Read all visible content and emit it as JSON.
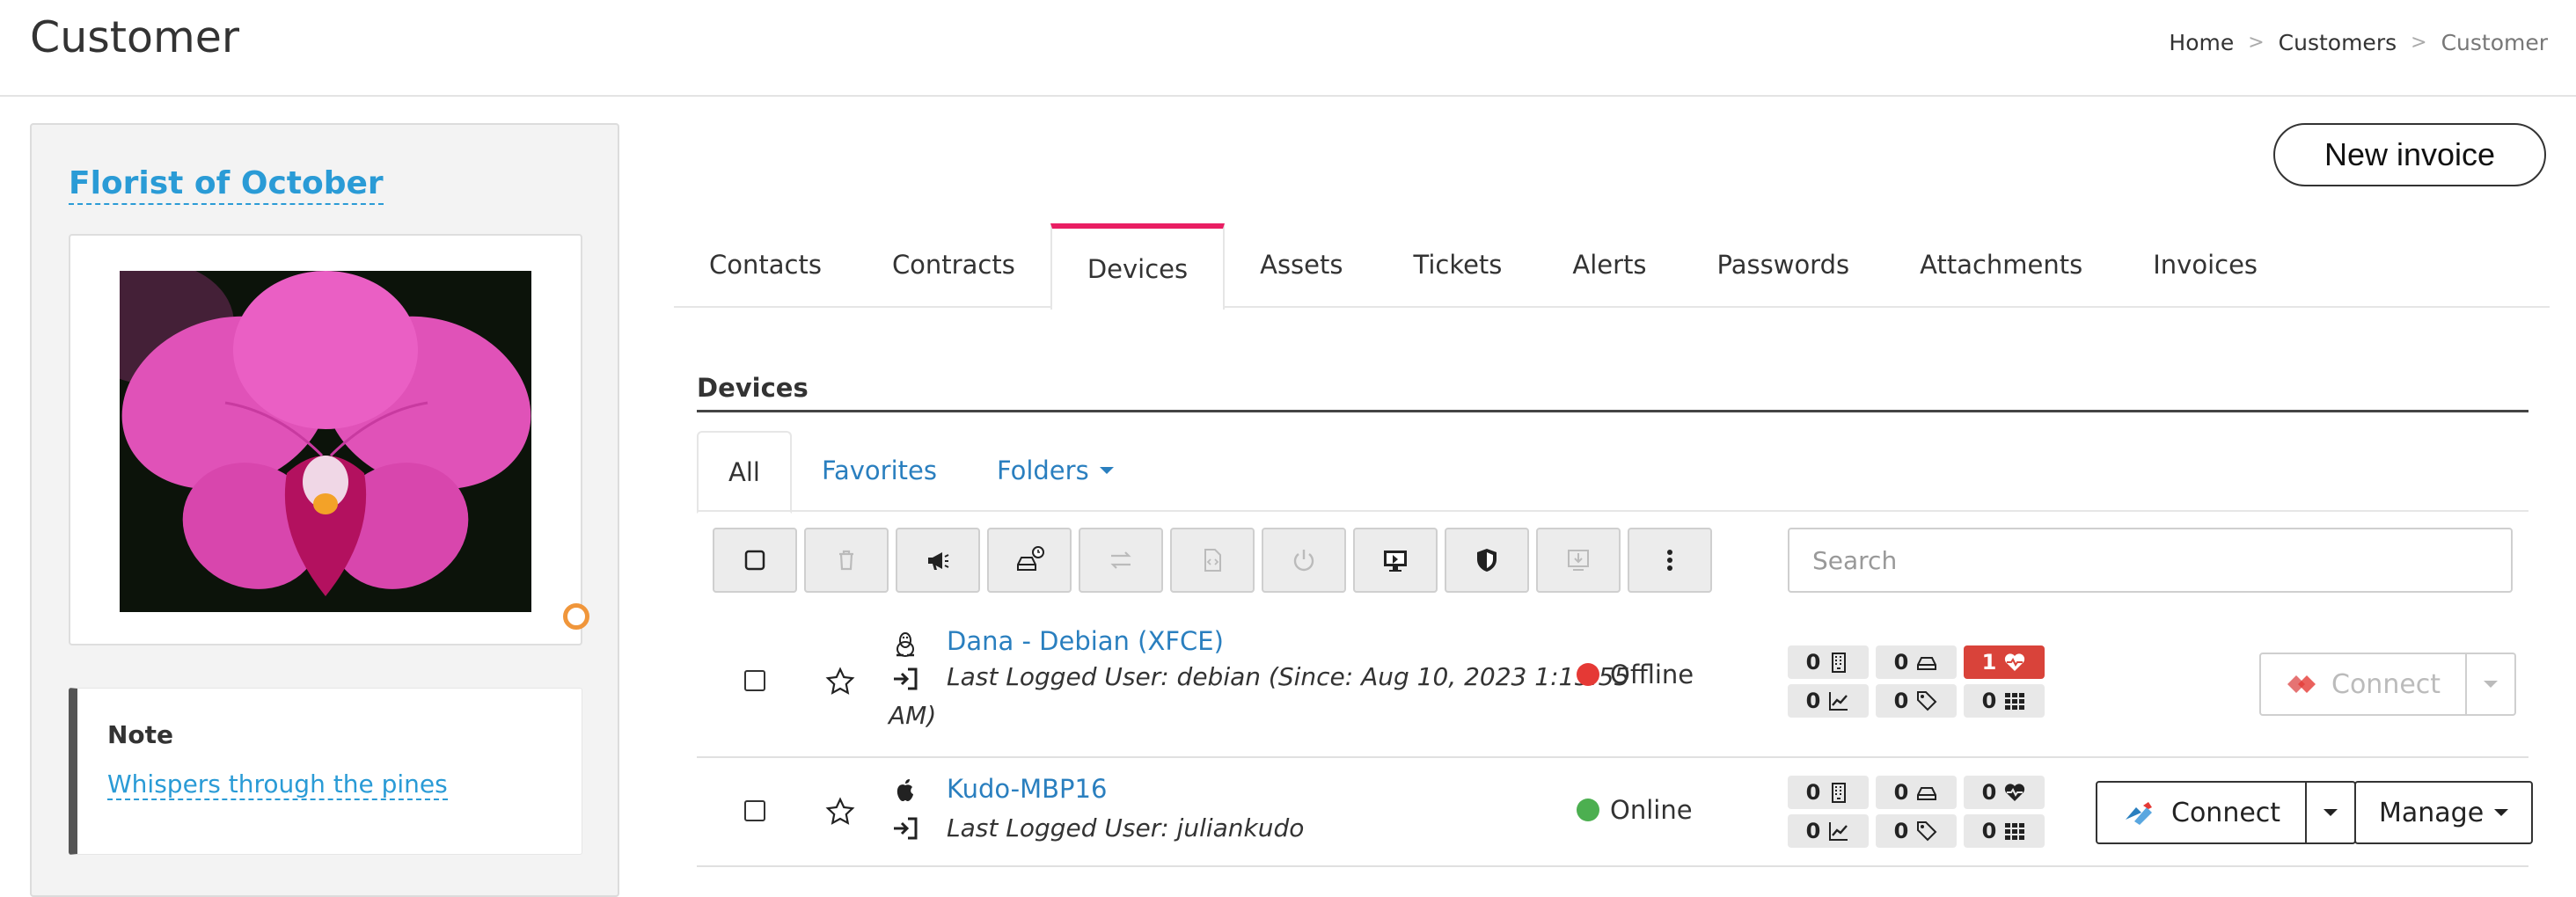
{
  "header": {
    "title": "Customer",
    "breadcrumb": [
      "Home",
      ">",
      "Customers",
      ">",
      "Customer"
    ]
  },
  "customer": {
    "name": "Florist of October",
    "note_title": "Note",
    "note_text": "Whispers through the pines"
  },
  "actions": {
    "new_invoice": "New invoice"
  },
  "tabs": [
    "Contacts",
    "Contracts",
    "Devices",
    "Assets",
    "Tickets",
    "Alerts",
    "Passwords",
    "Attachments",
    "Invoices"
  ],
  "active_tab": "Devices",
  "devices": {
    "heading": "Devices",
    "subtabs": {
      "all": "All",
      "favorites": "Favorites",
      "folders": "Folders"
    },
    "search_placeholder": "Search",
    "toolbar_icons": [
      "checkbox-icon",
      "trash-icon",
      "megaphone-icon",
      "drive-clock-icon",
      "transfer-icon",
      "script-icon",
      "power-icon",
      "monitor-icon",
      "shield-icon",
      "download-icon",
      "more-vertical-icon"
    ],
    "rows": [
      {
        "name": "Dana - Debian (XFCE)",
        "os_icon": "linux-icon",
        "user_line1": "Last Logged User: debian (Since: Aug 10, 2023 1:15:55",
        "user_line2": "AM)",
        "status": "Offline",
        "status_color": "#e53935",
        "badges": [
          "0",
          "0",
          "1",
          "0",
          "0",
          "0"
        ],
        "connect": "Connect",
        "connect_enabled": false
      },
      {
        "name": "Kudo-MBP16",
        "os_icon": "apple-icon",
        "user_line1": "Last Logged User: juliankudo",
        "status": "Online",
        "status_color": "#4caf50",
        "badges": [
          "0",
          "0",
          "0",
          "0",
          "0",
          "0"
        ],
        "connect": "Connect",
        "connect_enabled": true,
        "manage": "Manage"
      }
    ]
  },
  "colors": {
    "link": "#2a7fbf",
    "accent": "#e91e63",
    "alert": "#d9433a"
  }
}
